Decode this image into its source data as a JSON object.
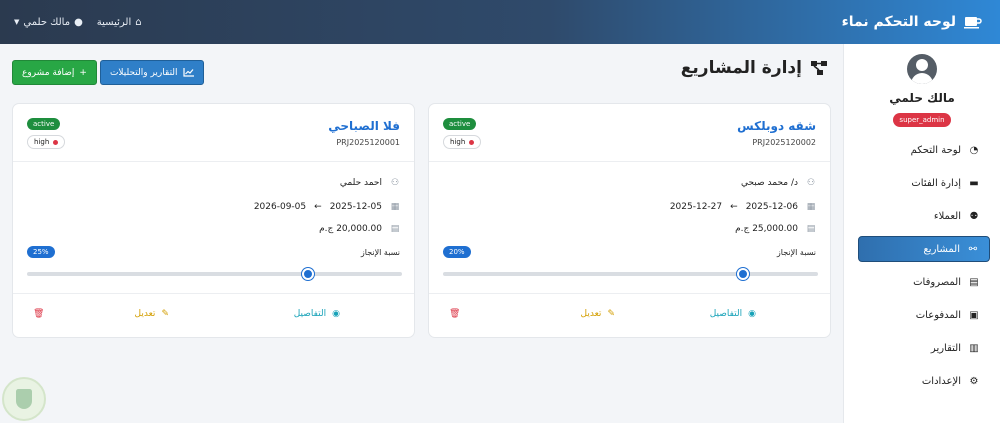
{
  "header": {
    "brand_title": "لوحه التحكم نماء",
    "home_label": "الرئيسية",
    "user_label": "مالك حلمي"
  },
  "sidebar": {
    "user_name": "مالك حلمي",
    "role": "super_admin",
    "items": [
      {
        "label": "لوحة التحكم",
        "icon": "gauge-icon",
        "active": false
      },
      {
        "label": "إدارة الفئات",
        "icon": "folder-icon",
        "active": false
      },
      {
        "label": "العملاء",
        "icon": "users-icon",
        "active": false
      },
      {
        "label": "المشاريع",
        "icon": "project-diagram-icon",
        "active": true
      },
      {
        "label": "المصروفات",
        "icon": "receipt-icon",
        "active": false
      },
      {
        "label": "المدفوعات",
        "icon": "money-icon",
        "active": false
      },
      {
        "label": "التقارير",
        "icon": "chart-icon",
        "active": false
      },
      {
        "label": "الإعدادات",
        "icon": "gear-icon",
        "active": false
      }
    ]
  },
  "page": {
    "title": "إدارة المشاريع",
    "reports_button": "التقارير والتحليلات",
    "add_button": "إضافة مشروع"
  },
  "projects": [
    {
      "name": "شقه دوبلكس",
      "code": "PRJ2025120002",
      "status": "active",
      "priority": "high",
      "client": "د/ محمد صبحي",
      "start_date": "2025-12-06",
      "end_date": "2025-12-27",
      "amount": "25,000.00 ج.م",
      "progress_label": "نسبة الإنجاز",
      "progress": "20%",
      "progress_value": 0.2,
      "details": "التفاصيل",
      "edit": "تعديل"
    },
    {
      "name": "فلا الصباحي",
      "code": "PRJ2025120001",
      "status": "active",
      "priority": "high",
      "client": "احمد حلمي",
      "start_date": "2025-12-05",
      "end_date": "2026-09-05",
      "amount": "20,000.00 ج.م",
      "progress_label": "نسبة الإنجاز",
      "progress": "25%",
      "progress_value": 0.25,
      "details": "التفاصيل",
      "edit": "تعديل"
    }
  ],
  "colors": {
    "accent": "#1f6fd1",
    "success": "#28a745",
    "danger": "#dc3545",
    "warning": "#d39e00",
    "info": "#17a2b8"
  }
}
